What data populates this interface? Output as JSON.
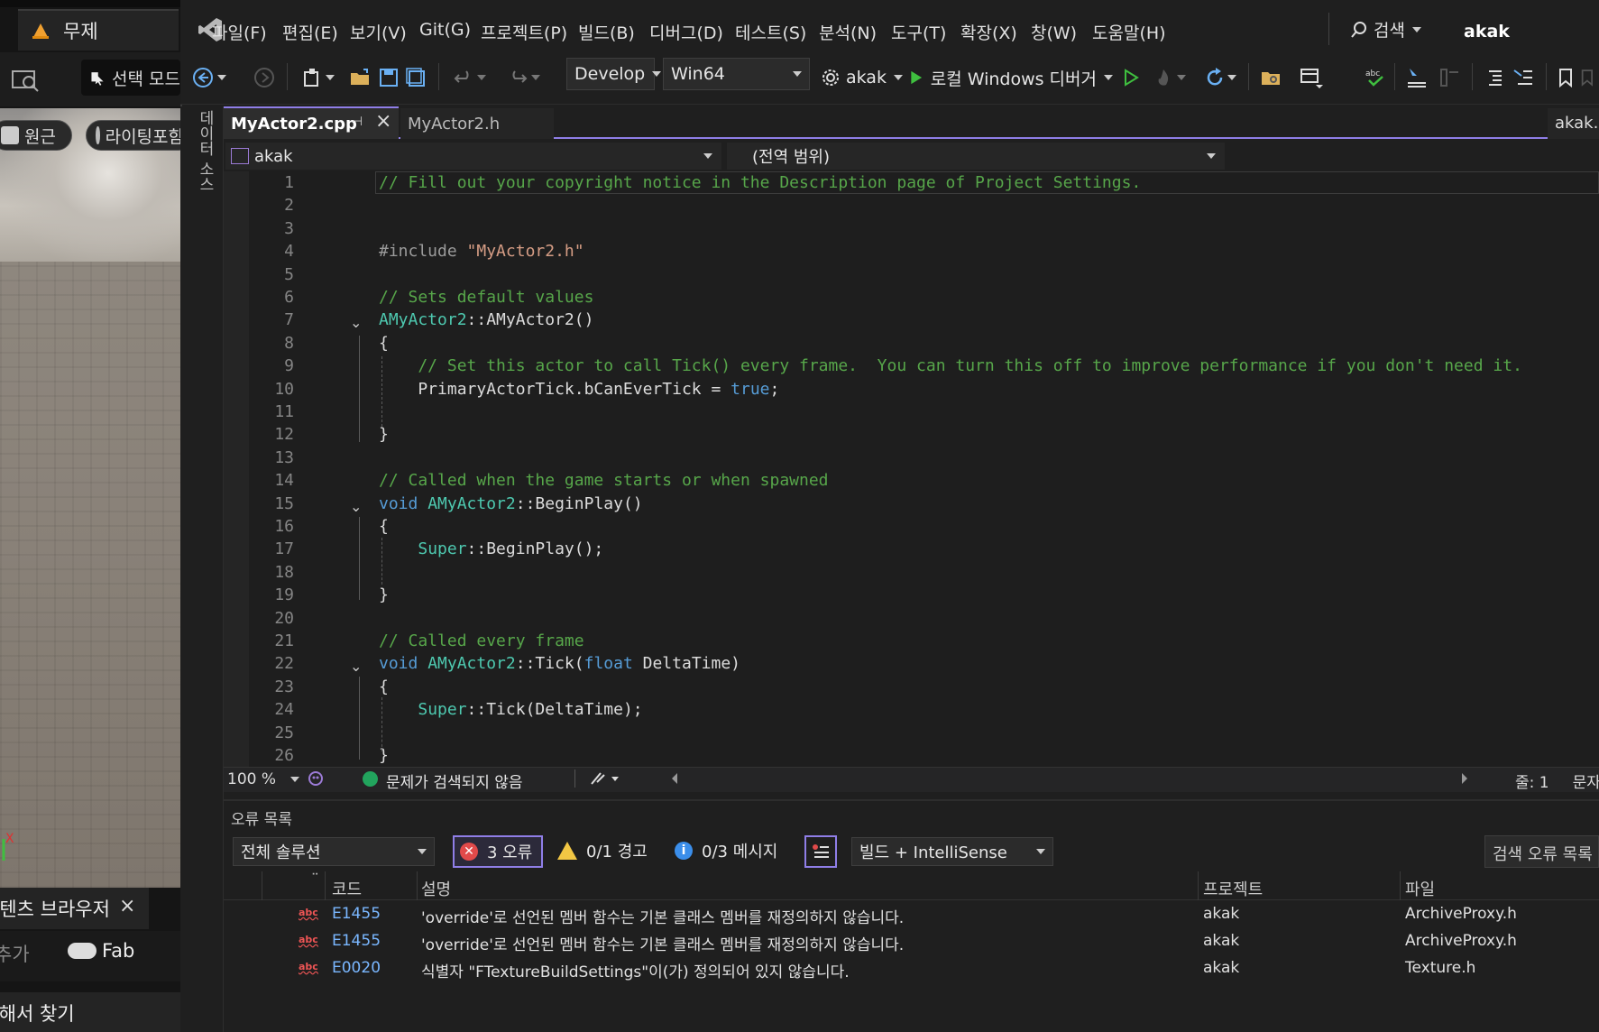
{
  "unreal": {
    "level_tab": "무제",
    "select_mode": "선택 모드",
    "view_pill1": "원근",
    "view_pill2": "라이팅포함",
    "content_browser_tab": "콘텐츠 브라우저",
    "add_label": "추가",
    "fab_label": "Fab",
    "find_label": "검색해서 찾기",
    "axis_label": "X"
  },
  "menubar": {
    "items": [
      "파일(F)",
      "편집(E)",
      "보기(V)",
      "Git(G)",
      "프로젝트(P)",
      "빌드(B)",
      "디버그(D)",
      "테스트(S)",
      "분석(N)",
      "도구(T)",
      "확장(X)",
      "창(W)",
      "도움말(H)"
    ],
    "search_label": "검색",
    "solution_name": "akak"
  },
  "toolbar": {
    "config": "Develop",
    "platform": "Win64",
    "startup_project": "akak",
    "run_label": "로컬 Windows 디버거"
  },
  "side_strip": {
    "label": "데이터 소스"
  },
  "tabs": {
    "active": "MyActor2.cpp",
    "inactive": "MyActor2.h",
    "right": "akak.Build.cs"
  },
  "navbar": {
    "project": "akak",
    "scope": "(전역 범위)"
  },
  "editor": {
    "line_numbers": [
      "1",
      "2",
      "3",
      "4",
      "5",
      "6",
      "7",
      "8",
      "9",
      "10",
      "11",
      "12",
      "13",
      "14",
      "15",
      "16",
      "17",
      "18",
      "19",
      "20",
      "21",
      "22",
      "23",
      "24",
      "25",
      "26"
    ],
    "lines": [
      "// Fill out your copyright notice in the Description page of Project Settings.",
      "",
      "",
      "#include \"MyActor2.h\"",
      "",
      "// Sets default values",
      "AMyActor2::AMyActor2()",
      "{",
      "    // Set this actor to call Tick() every frame.  You can turn this off to improve performance if you don't need it.",
      "    PrimaryActorTick.bCanEverTick = true;",
      "",
      "}",
      "",
      "// Called when the game starts or when spawned",
      "void AMyActor2::BeginPlay()",
      "{",
      "    Super::BeginPlay();",
      "",
      "}",
      "",
      "// Called every frame",
      "void AMyActor2::Tick(float DeltaTime)",
      "{",
      "    Super::Tick(DeltaTime);",
      "",
      "}"
    ]
  },
  "editor_status": {
    "zoom": "100 %",
    "issues": "문제가 검색되지 않음",
    "line_col": "줄: 1",
    "col_right": "문자"
  },
  "error_list": {
    "title": "오류 목록",
    "scope": "전체 솔루션",
    "errors_label": "3 오류",
    "warnings_label": "0/1 경고",
    "messages_label": "0/3 메시지",
    "source": "빌드 + IntelliSense",
    "search_placeholder": "검색 오류 목록",
    "columns": {
      "code": "코드",
      "description": "설명",
      "project": "프로젝트",
      "file": "파일"
    },
    "rows": [
      {
        "code": "E1455",
        "description": "'override'로 선언된 멤버 함수는 기본 클래스 멤버를 재정의하지 않습니다.",
        "project": "akak",
        "file": "ArchiveProxy.h"
      },
      {
        "code": "E1455",
        "description": "'override'로 선언된 멤버 함수는 기본 클래스 멤버를 재정의하지 않습니다.",
        "project": "akak",
        "file": "ArchiveProxy.h"
      },
      {
        "code": "E0020",
        "description": "식별자 \"FTextureBuildSettings\"이(가) 정의되어 있지 않습니다.",
        "project": "akak",
        "file": "Texture.h"
      }
    ],
    "icon_text": "abc"
  },
  "colors": {
    "accent": "#8f7ee7",
    "comment": "#57a64a",
    "keyword": "#569cd6",
    "type": "#4ec9b0",
    "string": "#d69d85",
    "error": "#e14a4a",
    "warning": "#f2c744",
    "info": "#3b8eea"
  }
}
